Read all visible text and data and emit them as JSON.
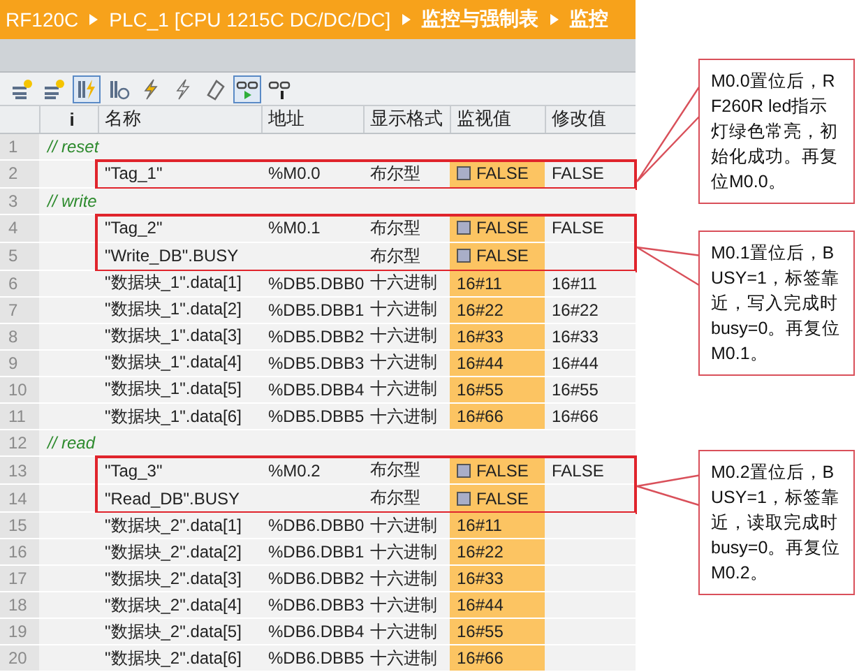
{
  "breadcrumb": [
    "RF120C",
    "PLC_1 [CPU 1215C DC/DC/DC]",
    "监控与强制表",
    "监控"
  ],
  "toolbar": [
    {
      "kind": "insert-row",
      "selected": false
    },
    {
      "kind": "add-row",
      "selected": false
    },
    {
      "kind": "modify-now",
      "selected": true
    },
    {
      "kind": "modify-trigger",
      "selected": false
    },
    {
      "kind": "modify-once",
      "selected": false
    },
    {
      "kind": "modify-trigger-off",
      "selected": false
    },
    {
      "kind": "force",
      "selected": false
    },
    {
      "kind": "monitor-all",
      "selected": true
    },
    {
      "kind": "monitor-once",
      "selected": false
    }
  ],
  "columns": [
    "i",
    "名称",
    "地址",
    "显示格式",
    "监视值",
    "修改值"
  ],
  "rows": [
    {
      "number": "1",
      "kind": "comment",
      "text": "// reset",
      "boxed": false
    },
    {
      "number": "2",
      "kind": "bool",
      "name": "\"Tag_1\"",
      "address": "%M0.0",
      "format": "布尔型",
      "monitor": "FALSE",
      "modify": "FALSE",
      "boxed": true
    },
    {
      "number": "3",
      "kind": "comment",
      "text": "// write",
      "boxed": false
    },
    {
      "number": "4",
      "kind": "bool",
      "name": "\"Tag_2\"",
      "address": "%M0.1",
      "format": "布尔型",
      "monitor": "FALSE",
      "modify": "FALSE",
      "boxed": true
    },
    {
      "number": "5",
      "kind": "bool",
      "name": "\"Write_DB\".BUSY",
      "format": "布尔型",
      "monitor": "FALSE",
      "boxed": true
    },
    {
      "number": "6",
      "kind": "hex",
      "name": "\"数据块_1\".data[1]",
      "address": "%DB5.DBB0",
      "format": "十六进制",
      "monitor": "16#11",
      "modify": "16#11",
      "boxed": false
    },
    {
      "number": "7",
      "kind": "hex",
      "name": "\"数据块_1\".data[2]",
      "address": "%DB5.DBB1",
      "format": "十六进制",
      "monitor": "16#22",
      "modify": "16#22",
      "boxed": false
    },
    {
      "number": "8",
      "kind": "hex",
      "name": "\"数据块_1\".data[3]",
      "address": "%DB5.DBB2",
      "format": "十六进制",
      "monitor": "16#33",
      "modify": "16#33",
      "boxed": false
    },
    {
      "number": "9",
      "kind": "hex",
      "name": "\"数据块_1\".data[4]",
      "address": "%DB5.DBB3",
      "format": "十六进制",
      "monitor": "16#44",
      "modify": "16#44",
      "boxed": false
    },
    {
      "number": "10",
      "kind": "hex",
      "name": "\"数据块_1\".data[5]",
      "address": "%DB5.DBB4",
      "format": "十六进制",
      "monitor": "16#55",
      "modify": "16#55",
      "boxed": false
    },
    {
      "number": "11",
      "kind": "hex",
      "name": "\"数据块_1\".data[6]",
      "address": "%DB5.DBB5",
      "format": "十六进制",
      "monitor": "16#66",
      "modify": "16#66",
      "boxed": false
    },
    {
      "number": "12",
      "kind": "comment",
      "text": "// read",
      "boxed": false
    },
    {
      "number": "13",
      "kind": "bool",
      "name": "\"Tag_3\"",
      "address": "%M0.2",
      "format": "布尔型",
      "monitor": "FALSE",
      "modify": "FALSE",
      "boxed": true
    },
    {
      "number": "14",
      "kind": "bool",
      "name": "\"Read_DB\".BUSY",
      "format": "布尔型",
      "monitor": "FALSE",
      "boxed": true
    },
    {
      "number": "15",
      "kind": "hex",
      "name": "\"数据块_2\".data[1]",
      "address": "%DB6.DBB0",
      "format": "十六进制",
      "monitor": "16#11",
      "boxed": false
    },
    {
      "number": "16",
      "kind": "hex",
      "name": "\"数据块_2\".data[2]",
      "address": "%DB6.DBB1",
      "format": "十六进制",
      "monitor": "16#22",
      "boxed": false
    },
    {
      "number": "17",
      "kind": "hex",
      "name": "\"数据块_2\".data[3]",
      "address": "%DB6.DBB2",
      "format": "十六进制",
      "monitor": "16#33",
      "boxed": false
    },
    {
      "number": "18",
      "kind": "hex",
      "name": "\"数据块_2\".data[4]",
      "address": "%DB6.DBB3",
      "format": "十六进制",
      "monitor": "16#44",
      "boxed": false
    },
    {
      "number": "19",
      "kind": "hex",
      "name": "\"数据块_2\".data[5]",
      "address": "%DB6.DBB4",
      "format": "十六进制",
      "monitor": "16#55",
      "boxed": false
    },
    {
      "number": "20",
      "kind": "hex",
      "name": "\"数据块_2\".data[6]",
      "address": "%DB6.DBB5",
      "format": "十六进制",
      "monitor": "16#66",
      "boxed": false
    }
  ],
  "callouts": [
    {
      "text": "M0.0置位后，RF260R led指示灯绿色常亮，初始化成功。再复位M0.0。"
    },
    {
      "text": "M0.1置位后，BUSY=1，标签靠近，写入完成时busy=0。再复位M0.1。"
    },
    {
      "text": "M0.2置位后，BUSY=1，标签靠近，读取完成时busy=0。再复位M0.2。"
    }
  ]
}
